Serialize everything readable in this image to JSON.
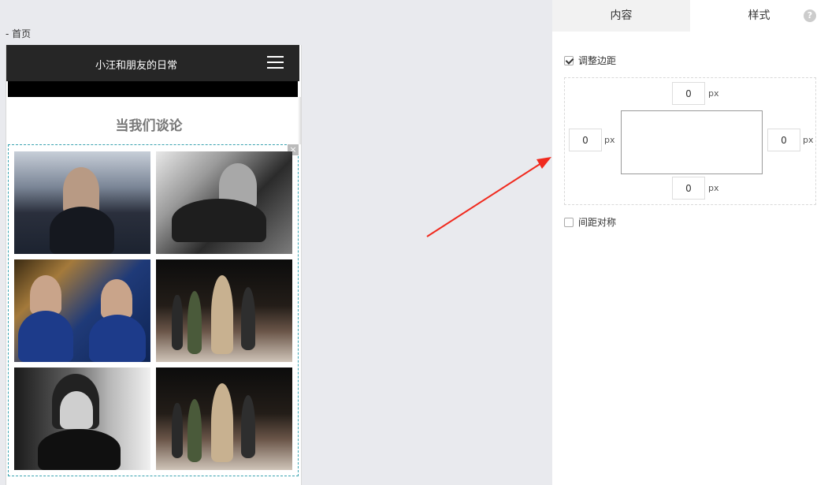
{
  "breadcrumb": "- 首页",
  "phone": {
    "title": "小汪和朋友的日常",
    "section_title": "当我们谈论",
    "gallery_close": "×"
  },
  "panel": {
    "tabs": [
      "内容",
      "样式"
    ],
    "active_tab": "样式",
    "help": "?",
    "adjust_margin_label": "调整边距",
    "adjust_margin_checked": true,
    "margin": {
      "top": "0",
      "left": "0",
      "right": "0",
      "bottom": "0",
      "unit": "px"
    },
    "symmetric_label": "间距对称",
    "symmetric_checked": false
  },
  "colors": {
    "arrow": "#f02a1e",
    "header": "#262626",
    "dashed_border": "#3aa3b0"
  }
}
